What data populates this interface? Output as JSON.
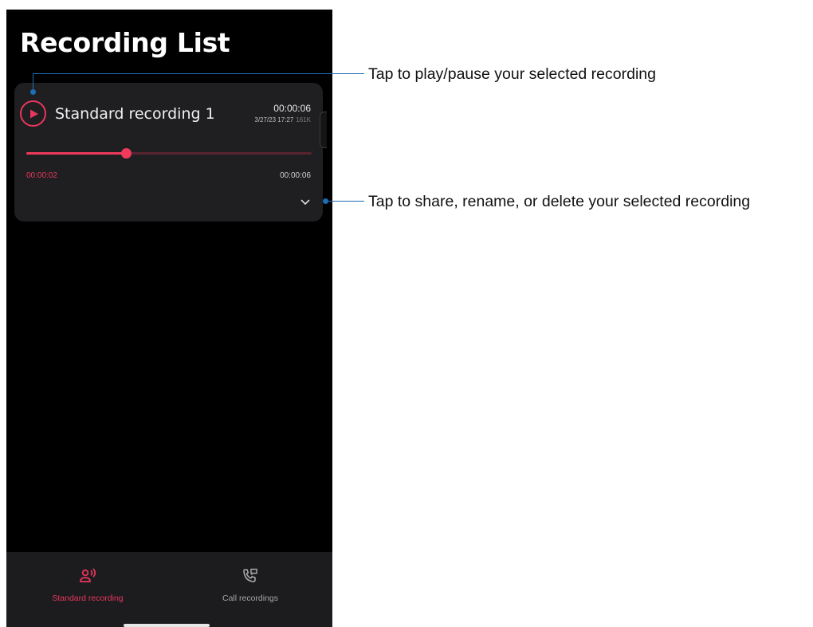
{
  "screen": {
    "title": "Recording List"
  },
  "recording": {
    "name": "Standard recording 1",
    "duration": "00:00:06",
    "date": "3/27/23 17:27",
    "size": "161K",
    "current_time": "00:00:02",
    "total_time": "00:00:06",
    "progress_fraction": 0.35
  },
  "bottom_nav": {
    "tabs": [
      {
        "label": "Standard recording",
        "icon": "person-voice-icon",
        "active": true
      },
      {
        "label": "Call recordings",
        "icon": "phone-call-icon",
        "active": false
      }
    ]
  },
  "callouts": {
    "play": "Tap to play/pause your selected recording",
    "options": "Tap to share, rename, or delete your selected recording"
  },
  "colors": {
    "accent": "#e8365d",
    "callout_line": "#1b6fb6",
    "background": "#000000",
    "card": "#1f1f21",
    "nav": "#1c1c1e"
  }
}
